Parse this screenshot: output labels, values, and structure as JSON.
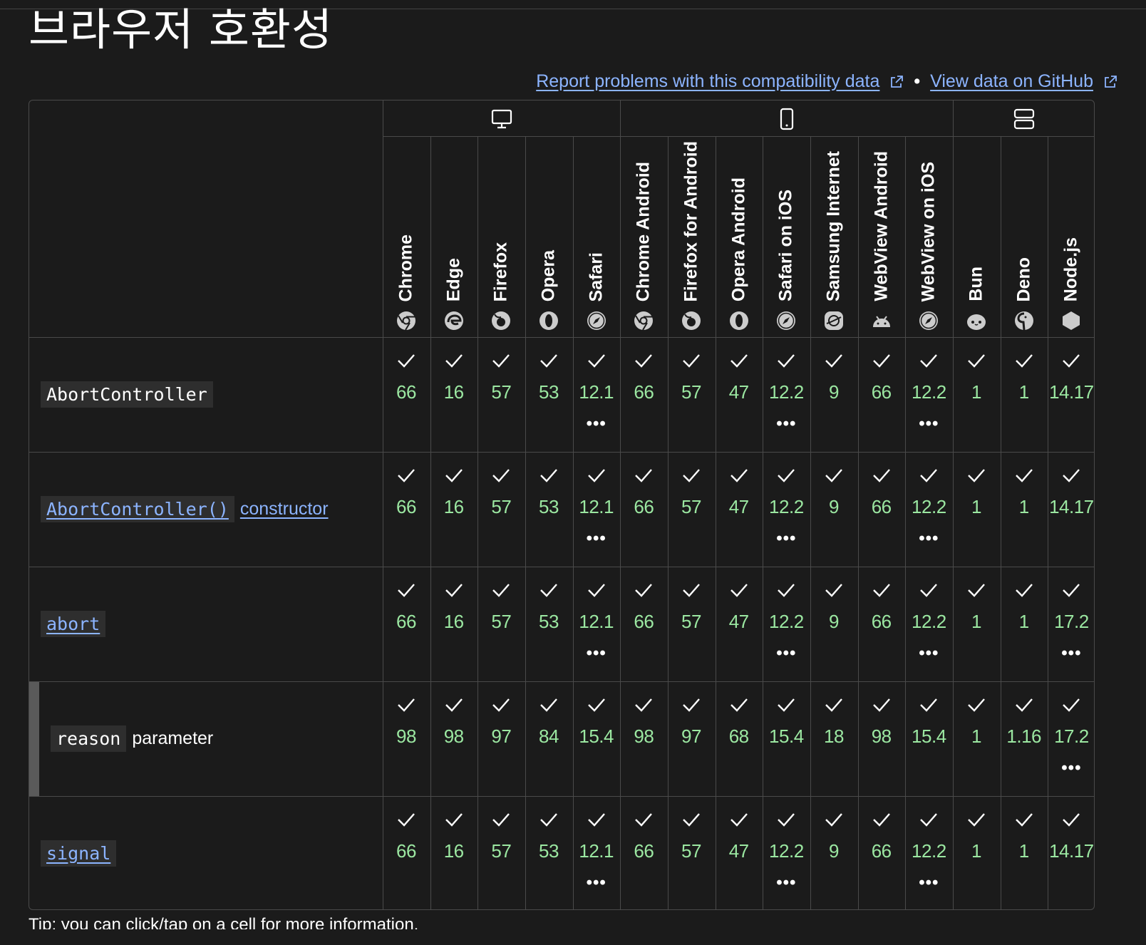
{
  "page": {
    "title": "브라우저 호환성",
    "report_link": "Report problems with this compatibility data",
    "separator": "•",
    "github_link": "View data on GitHub",
    "footer_text": "Tip: you can click/tap on a cell for more information."
  },
  "platforms": [
    {
      "name": "desktop-icon"
    },
    {
      "name": "mobile-icon"
    },
    {
      "name": "server-icon"
    }
  ],
  "browsers": [
    {
      "name": "Chrome",
      "icon": "chrome-icon"
    },
    {
      "name": "Edge",
      "icon": "edge-icon"
    },
    {
      "name": "Firefox",
      "icon": "firefox-icon"
    },
    {
      "name": "Opera",
      "icon": "opera-icon"
    },
    {
      "name": "Safari",
      "icon": "safari-icon"
    },
    {
      "name": "Chrome Android",
      "icon": "chrome-icon"
    },
    {
      "name": "Firefox for Android",
      "icon": "firefox-icon"
    },
    {
      "name": "Opera Android",
      "icon": "opera-icon"
    },
    {
      "name": "Safari on iOS",
      "icon": "safari-icon"
    },
    {
      "name": "Samsung Internet",
      "icon": "samsung-internet-icon"
    },
    {
      "name": "WebView Android",
      "icon": "android-icon"
    },
    {
      "name": "WebView on iOS",
      "icon": "safari-icon"
    },
    {
      "name": "Bun",
      "icon": "bun-icon"
    },
    {
      "name": "Deno",
      "icon": "deno-icon"
    },
    {
      "name": "Node.js",
      "icon": "nodejs-icon"
    }
  ],
  "features": [
    {
      "code": "AbortController",
      "text": "",
      "link": false,
      "versions": [
        "66",
        "16",
        "57",
        "53",
        "12.1",
        "66",
        "57",
        "47",
        "12.2",
        "9",
        "66",
        "12.2",
        "1",
        "1",
        "14.17"
      ],
      "more": [
        false,
        false,
        false,
        false,
        true,
        false,
        false,
        false,
        true,
        false,
        false,
        true,
        false,
        false,
        false
      ]
    },
    {
      "code": "AbortController()",
      "text": "constructor",
      "link": true,
      "versions": [
        "66",
        "16",
        "57",
        "53",
        "12.1",
        "66",
        "57",
        "47",
        "12.2",
        "9",
        "66",
        "12.2",
        "1",
        "1",
        "14.17"
      ],
      "more": [
        false,
        false,
        false,
        false,
        true,
        false,
        false,
        false,
        true,
        false,
        false,
        true,
        false,
        false,
        false
      ]
    },
    {
      "code": "abort",
      "text": "",
      "link": true,
      "versions": [
        "66",
        "16",
        "57",
        "53",
        "12.1",
        "66",
        "57",
        "47",
        "12.2",
        "9",
        "66",
        "12.2",
        "1",
        "1",
        "17.2"
      ],
      "more": [
        false,
        false,
        false,
        false,
        true,
        false,
        false,
        false,
        true,
        false,
        false,
        true,
        false,
        false,
        true
      ]
    },
    {
      "code": "reason",
      "text": "parameter",
      "link": false,
      "sub": true,
      "versions": [
        "98",
        "98",
        "97",
        "84",
        "15.4",
        "98",
        "97",
        "68",
        "15.4",
        "18",
        "98",
        "15.4",
        "1",
        "1.16",
        "17.2"
      ],
      "more": [
        false,
        false,
        false,
        false,
        false,
        false,
        false,
        false,
        false,
        false,
        false,
        false,
        false,
        false,
        true
      ]
    },
    {
      "code": "signal",
      "text": "",
      "link": true,
      "versions": [
        "66",
        "16",
        "57",
        "53",
        "12.1",
        "66",
        "57",
        "47",
        "12.2",
        "9",
        "66",
        "12.2",
        "1",
        "1",
        "14.17"
      ],
      "more": [
        false,
        false,
        false,
        false,
        true,
        false,
        false,
        false,
        true,
        false,
        false,
        true,
        false,
        false,
        false
      ]
    }
  ],
  "more_symbol": "•••",
  "colors": {
    "accent_link": "#8cb4ff",
    "supported": "#9be7a1",
    "border": "#4a4a4a"
  }
}
